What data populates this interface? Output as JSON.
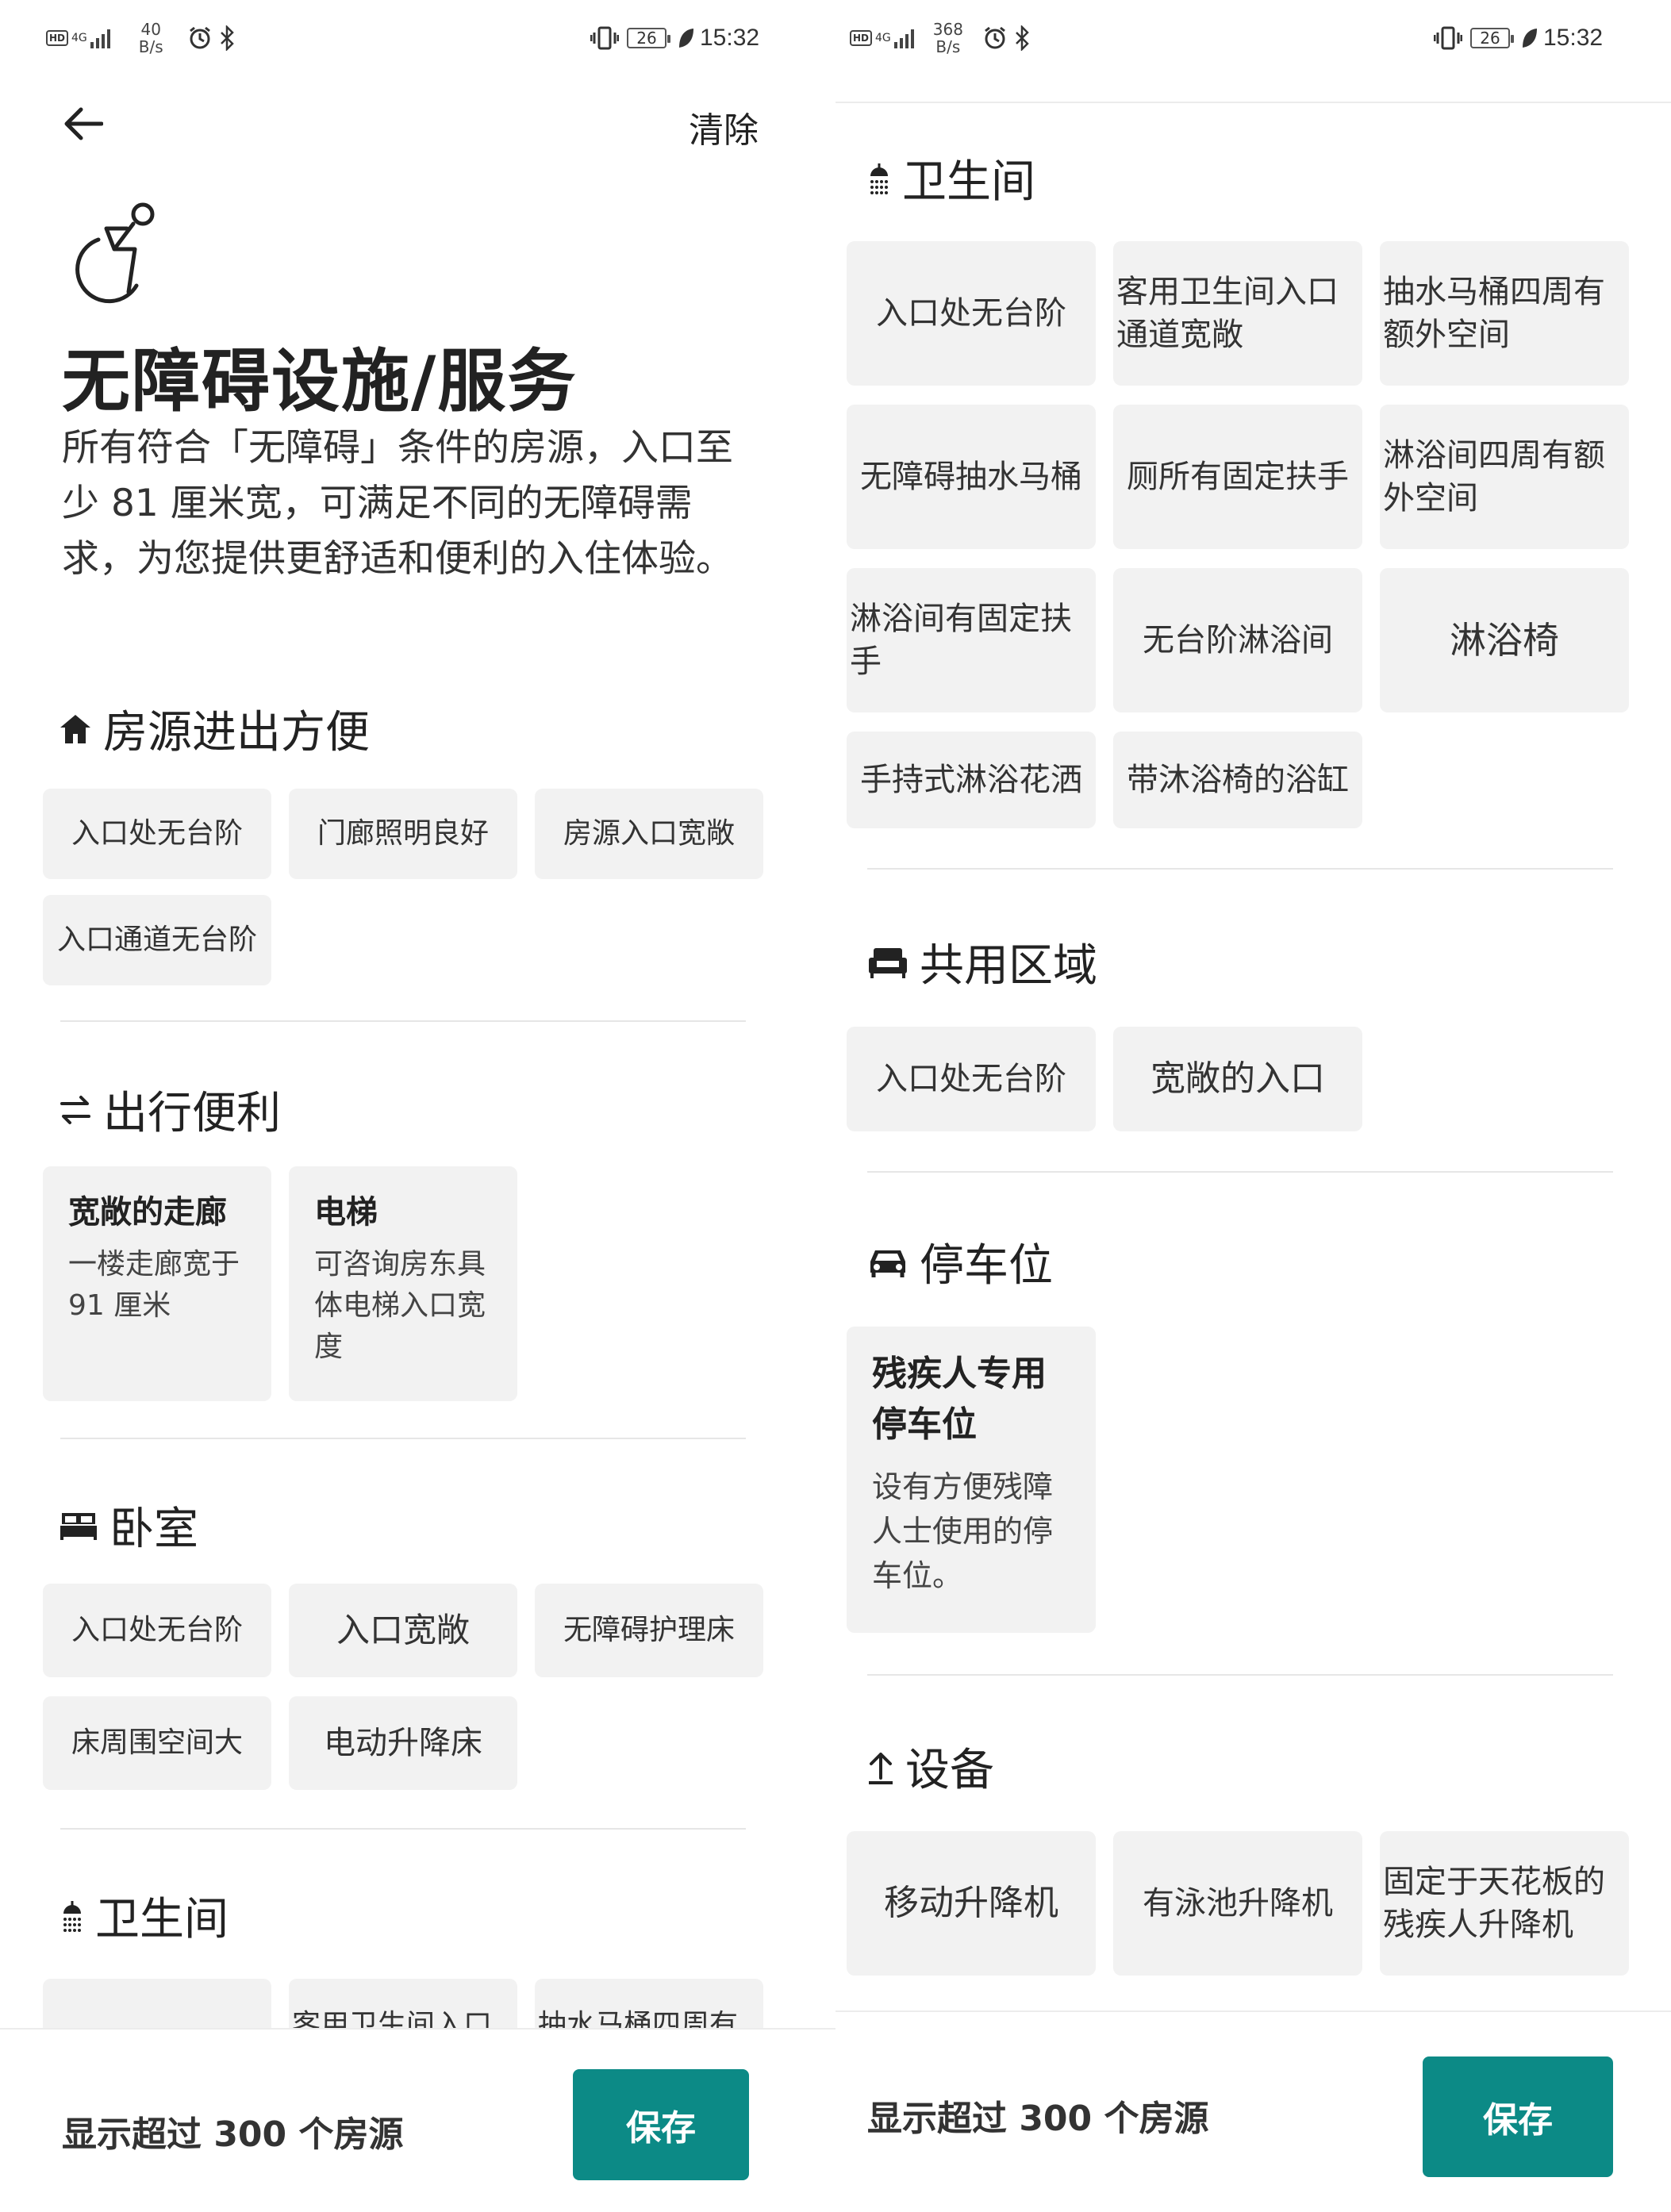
{
  "status": {
    "left": {
      "net_small": "40",
      "net_unit": "B/s",
      "battery": "26",
      "time": "15:32"
    },
    "right": {
      "net_small": "368",
      "net_unit": "B/s",
      "battery": "26",
      "time": "15:32"
    },
    "net_type": "4G",
    "hd": "HD"
  },
  "header": {
    "clear_label": "清除",
    "title": "无障碍设施/服务",
    "description": "所有符合「无障碍」条件的房源，入口至少 81 厘米宽，可满足不同的无障碍需求，为您提供更舒适和便利的入住体验。"
  },
  "sections": {
    "entry": {
      "title": "房源进出方便",
      "chips": [
        "入口处无台阶",
        "门廊照明良好",
        "房源入口宽敞",
        "入口通道无台阶"
      ]
    },
    "travel": {
      "title": "出行便利",
      "cards": [
        {
          "title": "宽敞的走廊",
          "desc": "一楼走廊宽于 91 厘米"
        },
        {
          "title": "电梯",
          "desc": "可咨询房东具体电梯入口宽度"
        }
      ]
    },
    "bedroom": {
      "title": "卧室",
      "chips": [
        "入口处无台阶",
        "入口宽敞",
        "无障碍护理床",
        "床周围空间大",
        "电动升降床"
      ]
    },
    "bathroom": {
      "title": "卫生间",
      "chips": [
        "入口处无台阶",
        "客用卫生间入口通道宽敞",
        "抽水马桶四周有额外空间",
        "无障碍抽水马桶",
        "厕所有固定扶手",
        "淋浴间四周有额外空间",
        "淋浴间有固定扶手",
        "无台阶淋浴间",
        "淋浴椅",
        "手持式淋浴花洒",
        "带沐浴椅的浴缸"
      ]
    },
    "common": {
      "title": "共用区域",
      "chips": [
        "入口处无台阶",
        "宽敞的入口"
      ]
    },
    "parking": {
      "title": "停车位",
      "card": {
        "title": "残疾人专用停车位",
        "desc": "设有方便残障人士使用的停车位。"
      }
    },
    "equipment": {
      "title": "设备",
      "chips": [
        "移动升降机",
        "有泳池升降机",
        "固定于天花板的残疾人升降机"
      ]
    }
  },
  "footer": {
    "count_label": "显示超过 300 个房源",
    "save_label": "保存"
  },
  "colors": {
    "accent": "#0c8a86",
    "chip_bg": "#f2f2f2"
  }
}
